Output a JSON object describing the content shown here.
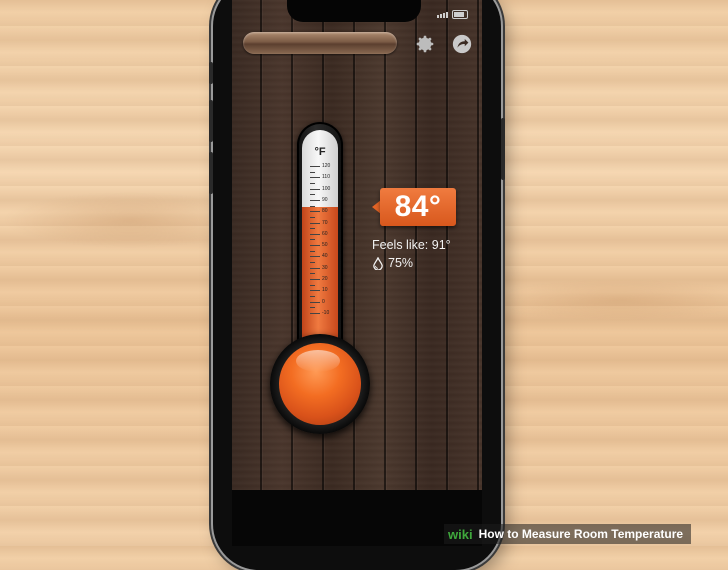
{
  "thermometer": {
    "unit": "°F",
    "scale": [
      "120",
      "110",
      "100",
      "90",
      "80",
      "70",
      "60",
      "50",
      "40",
      "30",
      "20",
      "10",
      "0",
      "-10"
    ],
    "current_value_f": 84
  },
  "reading": {
    "temperature": "84°",
    "feels_like": "Feels like: 91°",
    "humidity": "75%"
  },
  "toolbar": {
    "settings_icon": "gear-icon",
    "share_icon": "share-icon"
  },
  "caption": {
    "logo": "wiki",
    "title": "How to Measure Room Temperature"
  },
  "colors": {
    "accent": "#e36426",
    "mercury": "#e3602a",
    "wiki_green": "#3fa83c"
  }
}
